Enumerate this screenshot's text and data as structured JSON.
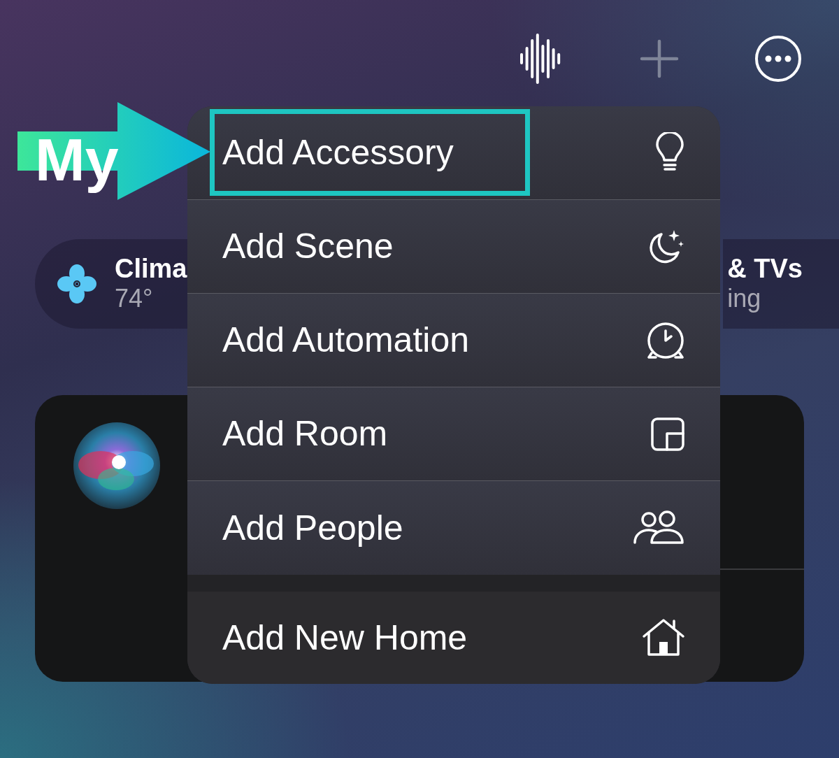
{
  "toolbar": [
    {
      "kind": "voice",
      "disabled": false
    },
    {
      "kind": "add",
      "disabled": true
    },
    {
      "kind": "more",
      "disabled": false
    }
  ],
  "title": "My",
  "chips": [
    {
      "kind": "climate",
      "title": "Clima",
      "subtitle": "74°"
    },
    {
      "kind": "media",
      "title": "& TVs",
      "subtitle": "ing"
    }
  ],
  "menu": {
    "sections": [
      {
        "items": [
          {
            "label": "Add Accessory",
            "kind": "bulb",
            "highlighted": true
          },
          {
            "label": "Add Scene",
            "kind": "scene",
            "highlighted": false
          },
          {
            "label": "Add Automation",
            "kind": "automation",
            "highlighted": false
          },
          {
            "label": "Add Room",
            "kind": "room",
            "highlighted": false
          },
          {
            "label": "Add People",
            "kind": "people",
            "highlighted": false
          }
        ]
      },
      {
        "items": [
          {
            "label": "Add New Home",
            "kind": "home",
            "highlighted": false
          }
        ]
      }
    ]
  }
}
